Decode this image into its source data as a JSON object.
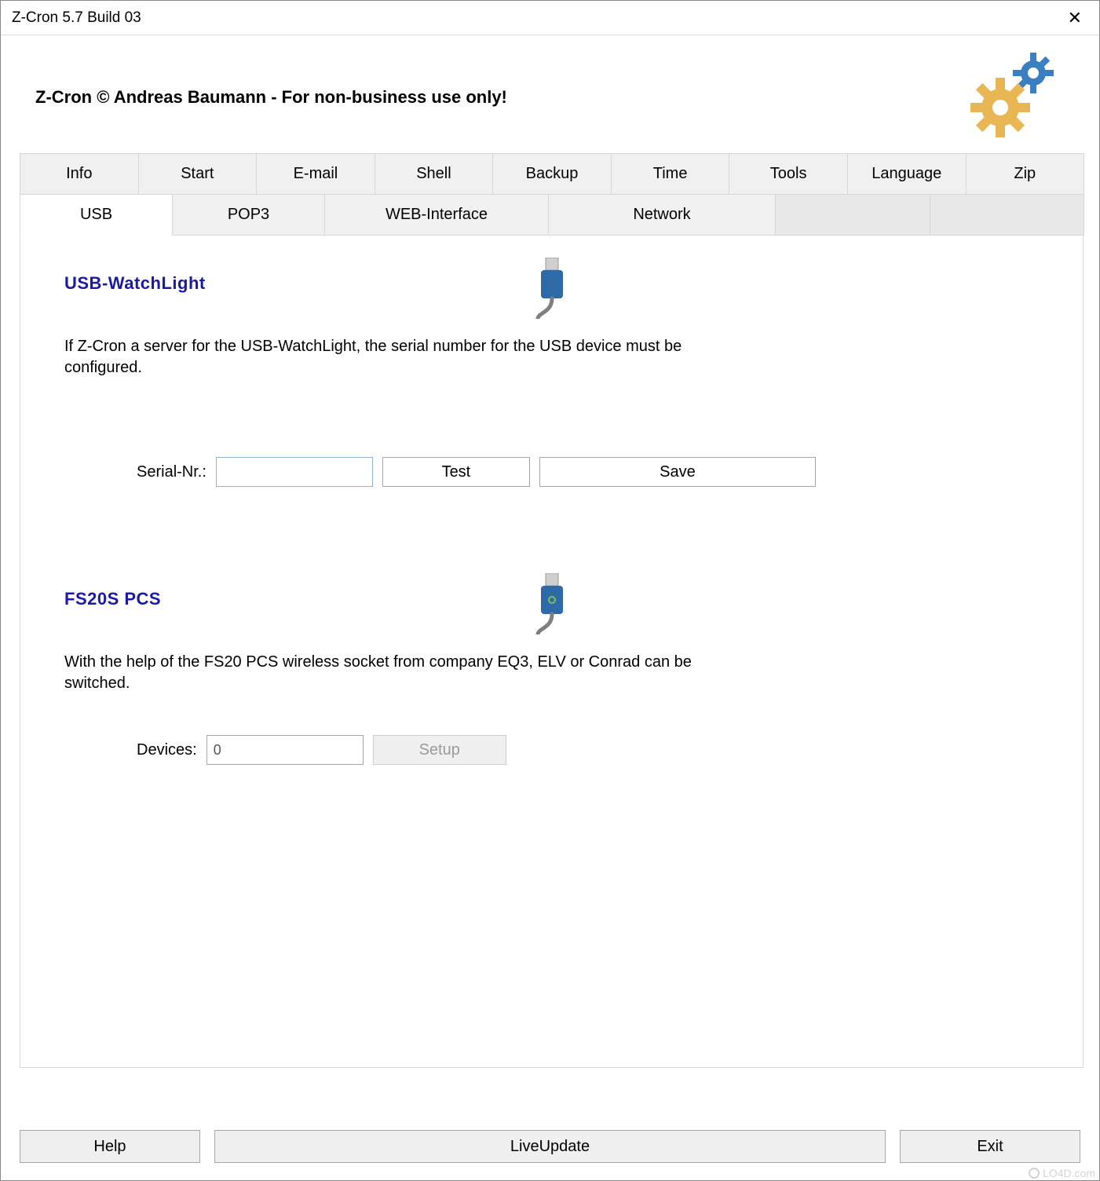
{
  "window": {
    "title": "Z-Cron 5.7 Build 03"
  },
  "header": {
    "title": "Z-Cron © Andreas Baumann - For non-business use only!"
  },
  "tabs": {
    "row1": [
      "Info",
      "Start",
      "E-mail",
      "Shell",
      "Backup",
      "Time",
      "Tools",
      "Language",
      "Zip"
    ],
    "row2": [
      "USB",
      "POP3",
      "WEB-Interface",
      "Network"
    ],
    "active": "USB"
  },
  "usb": {
    "watchlight": {
      "title": "USB-WatchLight",
      "desc": "If Z-Cron a server for the USB-WatchLight, the serial number for the USB device must be configured.",
      "serial_label": "Serial-Nr.:",
      "serial_value": "",
      "test_label": "Test",
      "save_label": "Save"
    },
    "fs20": {
      "title": "FS20S PCS",
      "desc": "With the help of the FS20 PCS wireless socket from company EQ3, ELV or Conrad can be switched.",
      "devices_label": "Devices:",
      "devices_value": "0",
      "setup_label": "Setup"
    }
  },
  "buttons": {
    "help": "Help",
    "liveupdate": "LiveUpdate",
    "exit": "Exit"
  },
  "watermark": {
    "big": "LO4D.com",
    "small": "LO4D.com"
  }
}
